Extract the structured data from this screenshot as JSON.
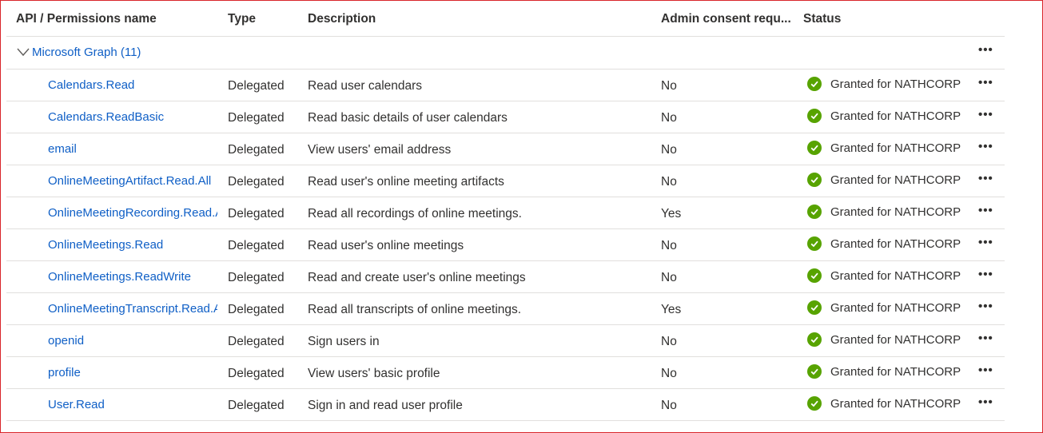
{
  "headers": {
    "name": "API / Permissions name",
    "type": "Type",
    "description": "Description",
    "admin": "Admin consent requ...",
    "status": "Status"
  },
  "group": {
    "label": "Microsoft Graph (11)",
    "more": "•••"
  },
  "rows": [
    {
      "name": "Calendars.Read",
      "type": "Delegated",
      "description": "Read user calendars",
      "admin": "No",
      "status": "Granted for NATHCORP",
      "more": "•••"
    },
    {
      "name": "Calendars.ReadBasic",
      "type": "Delegated",
      "description": "Read basic details of user calendars",
      "admin": "No",
      "status": "Granted for NATHCORP",
      "more": "•••"
    },
    {
      "name": "email",
      "type": "Delegated",
      "description": "View users' email address",
      "admin": "No",
      "status": "Granted for NATHCORP",
      "more": "•••"
    },
    {
      "name": "OnlineMeetingArtifact.Read.All",
      "type": "Delegated",
      "description": "Read user's online meeting artifacts",
      "admin": "No",
      "status": "Granted for NATHCORP",
      "more": "•••"
    },
    {
      "name": "OnlineMeetingRecording.Read.A",
      "type": "Delegated",
      "description": "Read all recordings of online meetings.",
      "admin": "Yes",
      "status": "Granted for NATHCORP",
      "more": "•••"
    },
    {
      "name": "OnlineMeetings.Read",
      "type": "Delegated",
      "description": "Read user's online meetings",
      "admin": "No",
      "status": "Granted for NATHCORP",
      "more": "•••"
    },
    {
      "name": "OnlineMeetings.ReadWrite",
      "type": "Delegated",
      "description": "Read and create user's online meetings",
      "admin": "No",
      "status": "Granted for NATHCORP",
      "more": "•••"
    },
    {
      "name": "OnlineMeetingTranscript.Read.A",
      "type": "Delegated",
      "description": "Read all transcripts of online meetings.",
      "admin": "Yes",
      "status": "Granted for NATHCORP",
      "more": "•••"
    },
    {
      "name": "openid",
      "type": "Delegated",
      "description": "Sign users in",
      "admin": "No",
      "status": "Granted for NATHCORP",
      "more": "•••"
    },
    {
      "name": "profile",
      "type": "Delegated",
      "description": "View users' basic profile",
      "admin": "No",
      "status": "Granted for NATHCORP",
      "more": "•••"
    },
    {
      "name": "User.Read",
      "type": "Delegated",
      "description": "Sign in and read user profile",
      "admin": "No",
      "status": "Granted for NATHCORP",
      "more": "•••"
    }
  ],
  "icons": {
    "granted": "check-circle-icon",
    "expand": "chevron-down-icon",
    "more": "more-horizontal-icon"
  },
  "colors": {
    "link": "#0f5fc6",
    "granted": "#57a300",
    "border": "#d9252a"
  }
}
